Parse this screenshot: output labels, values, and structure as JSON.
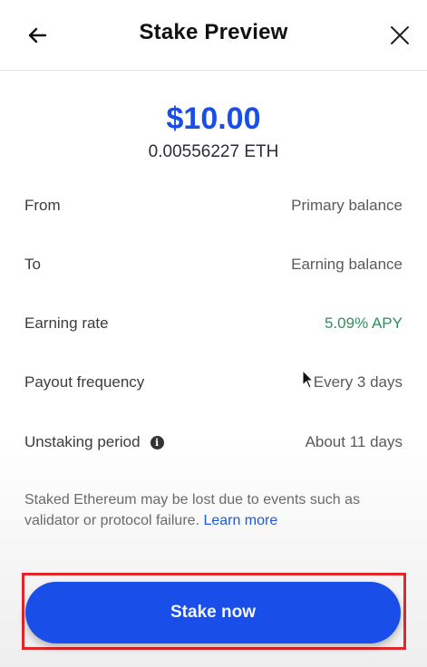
{
  "header": {
    "title": "Stake Preview",
    "back_icon": "arrow-left-icon",
    "close_icon": "close-icon"
  },
  "summary": {
    "fiat_amount": "$10.00",
    "crypto_amount": "0.00556227 ETH"
  },
  "details": [
    {
      "label": "From",
      "value": "Primary balance"
    },
    {
      "label": "To",
      "value": "Earning balance"
    },
    {
      "label": "Earning rate",
      "value": "5.09% APY"
    },
    {
      "label": "Payout frequency",
      "value": "Every 3 days"
    },
    {
      "label": "Unstaking period",
      "value": "About 11 days",
      "info_icon": "info-icon",
      "info_glyph": "i"
    }
  ],
  "disclaimer": {
    "text": "Staked Ethereum may be lost due to events such as validator or protocol failure.",
    "link": "Learn more"
  },
  "action": {
    "stake_label": "Stake now"
  },
  "colors": {
    "accent": "#1a4ee8",
    "positive": "#2e8f5b",
    "link": "#1f5bd6",
    "highlight": "#e3262b"
  }
}
